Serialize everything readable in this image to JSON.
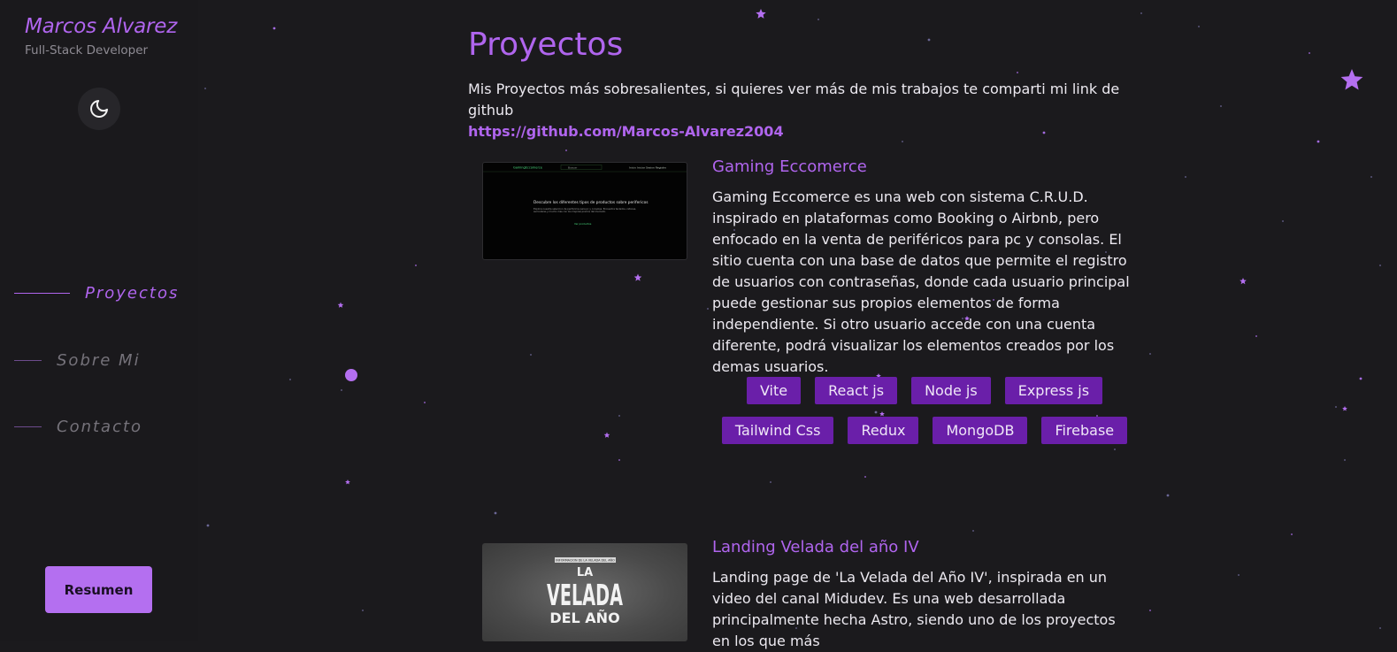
{
  "sidebar": {
    "name": "Marcos Alvarez",
    "role": "Full-Stack Developer",
    "theme_toggle_icon": "moon-icon",
    "nav": [
      {
        "label": "Proyectos",
        "active": true
      },
      {
        "label": "Sobre Mi",
        "active": false
      },
      {
        "label": "Contacto",
        "active": false
      }
    ],
    "resume_label": "Resumen"
  },
  "main": {
    "title": "Proyectos",
    "intro_text": "Mis Proyectos más sobresalientes, si quieres ver más de mis trabajos te comparti mi link de github",
    "github_link": "https://github.com/Marcos-Alvarez2004",
    "projects": [
      {
        "title": "Gaming Eccomerce",
        "description": "Gaming Eccomerce es una web con sistema C.R.U.D. inspirado en plataformas como Booking o Airbnb, pero enfocado en la venta de periféricos para pc y consolas. El sitio cuenta con una base de datos que permite el registro de usuarios con contraseñas, donde cada usuario principal puede gestionar sus propios elementos de forma independiente. Si otro usuario accede con una cuenta diferente, podrá visualizar los elementos creados por los demas usuarios.",
        "tags_row1": [
          "Vite",
          "React js",
          "Node js",
          "Express js"
        ],
        "tags_row2": [
          "Tailwind Css",
          "Redux",
          "MongoDB",
          "Firebase"
        ],
        "thumb": {
          "nav_brand": "GamingEccomerce",
          "nav_search": "Buscar",
          "nav_links": "Inicio  Iniciar Sesion  Registro",
          "heading": "Descubre los diferentes tipos de productos sobre perifericos",
          "body": "Explora nuestra seleccion de perifericos para pc y consolas. Encuentra teclados, ratones, auriculares y mucho mas con los mejores precios del mercado.",
          "cta": "Ver productos"
        }
      },
      {
        "title": "Landing Velada del año IV",
        "description": "Landing page de 'La Velada del Año IV', inspirada en un video del canal Midudev. Es una web desarrollada principalmente hecha Astro, siendo uno de los proyectos en los que más",
        "thumb": {
          "banner": "INFORMACION DE LA VELADA DEL AÑO",
          "logo_line1": "LA",
          "logo_line2": "VELADA",
          "logo_line3": "DEL AÑO"
        }
      }
    ]
  },
  "colors": {
    "accent": "#b065ee",
    "tag_bg": "#6a1fa9",
    "background": "#1b1a1d"
  }
}
